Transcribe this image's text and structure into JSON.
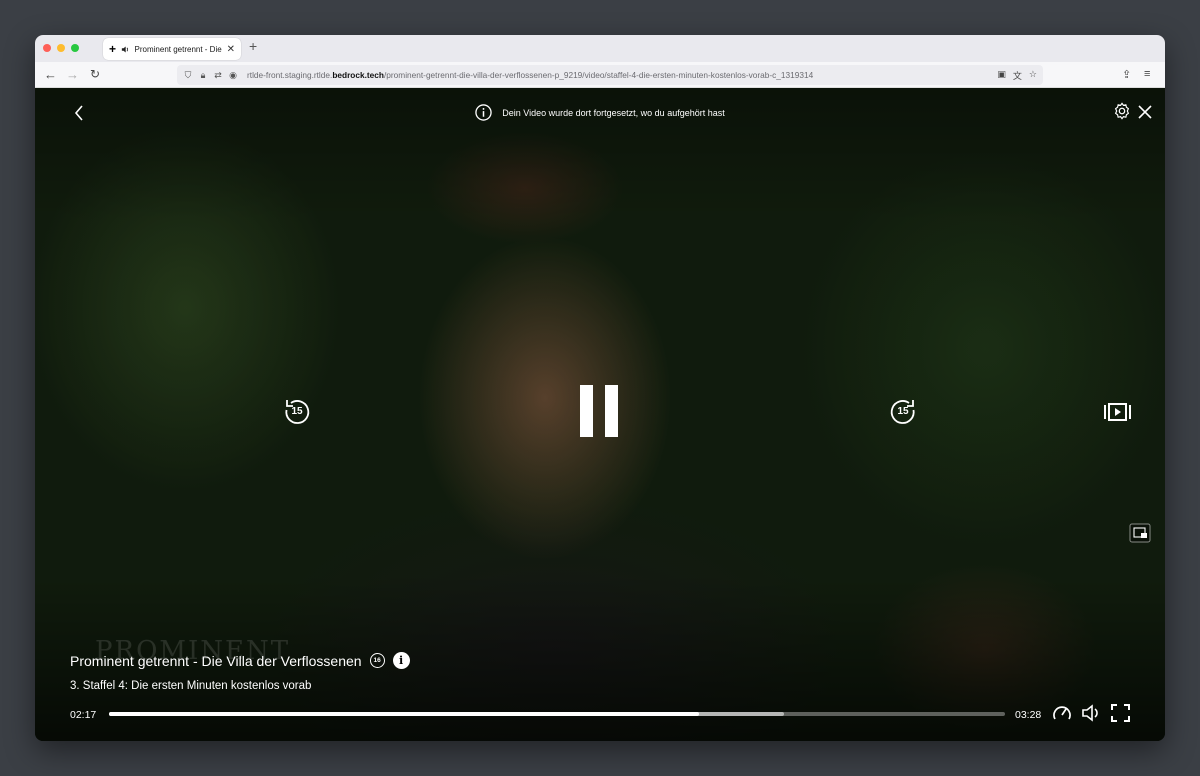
{
  "browser": {
    "tab_title": "Prominent getrennt - Die Villa der Verflossenen",
    "url_prefix": "rtlde-front.staging.rtlde.",
    "url_domain": "bedrock.tech",
    "url_path": "/prominent-getrennt-die-villa-der-verflossenen-p_9219/video/staffel-4-die-ersten-minuten-kostenlos-vorab-c_1319314"
  },
  "player": {
    "notice": "Dein Video wurde dort fortgesetzt, wo du aufgehört hast",
    "show_title": "Prominent getrennt - Die Villa der Verflossenen",
    "age_rating": "16",
    "episode_title": "3. Staffel 4: Die ersten Minuten kostenlos vorab",
    "current_time": "02:17",
    "duration": "03:28",
    "progress_fraction": 0.658,
    "buffered_fraction": 0.753,
    "skip_back_seconds": "15",
    "skip_forward_seconds": "15",
    "watermark": "PROMINENT"
  },
  "colors": {
    "traffic_red": "#fe5f57",
    "traffic_yellow": "#febc2e",
    "traffic_green": "#28c840"
  }
}
